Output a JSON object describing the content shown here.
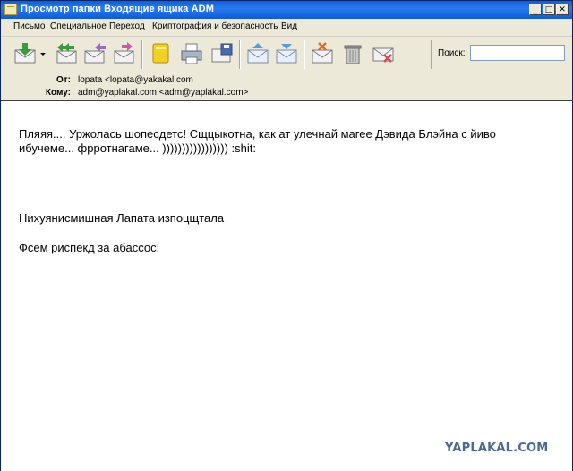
{
  "window": {
    "title": "Просмотр папки Входящие ящика ADM",
    "minimize_glyph": "_",
    "maximize_glyph": "□",
    "close_glyph": "✕"
  },
  "menu": {
    "items": [
      {
        "underline": "П",
        "rest": "исьмо"
      },
      {
        "underline": "С",
        "rest": "пециальное"
      },
      {
        "underline": "П",
        "rest": "ереход"
      },
      {
        "underline": "К",
        "rest": "риптография и безопасность"
      },
      {
        "underline": "В",
        "rest": "ид"
      }
    ]
  },
  "toolbar": {
    "search_label": "Поиск:",
    "search_value": "",
    "buttons": [
      {
        "icon": "get-mail-icon",
        "color": "#3c9a3c"
      },
      {
        "icon": "dropdown-arrow-icon",
        "color": "#000000"
      },
      {
        "icon": "reply-all-icon",
        "color": "#3c9a3c"
      },
      {
        "icon": "reply-icon",
        "color": "#9a6ac8"
      },
      {
        "icon": "forward-icon",
        "color": "#c85ab0"
      },
      {
        "icon": "address-book-icon",
        "color": "#e8c21a"
      },
      {
        "icon": "print-icon",
        "color": "#6a7a9a"
      },
      {
        "icon": "save-icon",
        "color": "#4a6aa8"
      },
      {
        "icon": "previous-message-icon",
        "color": "#5a9ad8"
      },
      {
        "icon": "next-message-icon",
        "color": "#5a9ad8"
      },
      {
        "icon": "mark-junk-icon",
        "color": "#e06a2a"
      },
      {
        "icon": "trash-icon",
        "color": "#8a8a8a"
      },
      {
        "icon": "delete-message-icon",
        "color": "#d84a4a"
      }
    ]
  },
  "headers": {
    "from_label": "От:",
    "from_value": "lopata  <lopata@yakakal.com",
    "to_label": "Кому:",
    "to_value": "adm@yaplakal.com <adm@yaplakal.com>"
  },
  "message": {
    "line1": "Пляяя.... Уржолась шопесдетс! Сщцыкотна, как ат улечнай магее Дэвида Блэйна с йиво",
    "line2": "ибучеме... фрротнагаме... )))))))))))))))))   :shit:",
    "line3": "Нихуянисмишная Лапата изпоцщтала",
    "line4": "Фсем риспекд за абассос!"
  },
  "watermark": "YAPLAKAL.COM"
}
